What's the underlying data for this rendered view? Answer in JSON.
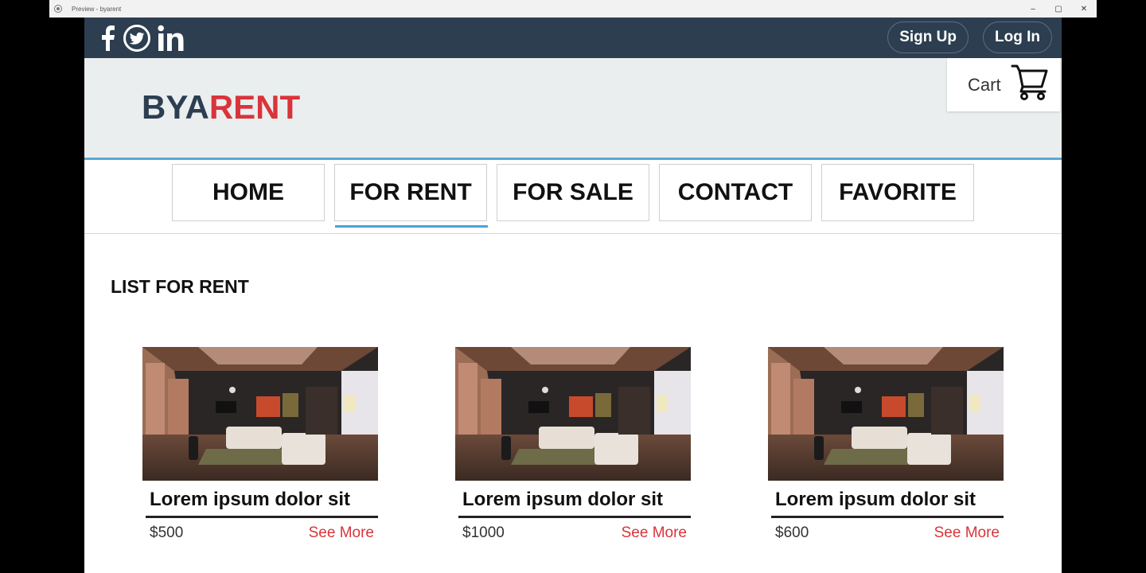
{
  "window": {
    "title": "Preview - byarent",
    "controls": [
      "–",
      "▢",
      "✕"
    ]
  },
  "topbar": {
    "social_icons": [
      "facebook-icon",
      "twitter-icon",
      "linkedin-icon"
    ],
    "sign_up": "Sign Up",
    "log_in": "Log In"
  },
  "header": {
    "logo_part1": "BYA",
    "logo_part2": "RENT",
    "cart_label": "Cart"
  },
  "nav": {
    "items": [
      {
        "label": "HOME",
        "active": false
      },
      {
        "label": "FOR RENT",
        "active": true
      },
      {
        "label": "FOR SALE",
        "active": false
      },
      {
        "label": "CONTACT",
        "active": false
      },
      {
        "label": "FAVORITE",
        "active": false
      }
    ]
  },
  "main": {
    "section_title": "LIST FOR RENT",
    "listings": [
      {
        "title": "Lorem ipsum dolor sit",
        "price": "$500",
        "link": "See More"
      },
      {
        "title": "Lorem ipsum dolor sit",
        "price": "$1000",
        "link": "See More"
      },
      {
        "title": "Lorem ipsum dolor sit",
        "price": "$600",
        "link": "See More"
      }
    ]
  },
  "colors": {
    "topbar": "#2c3e50",
    "brand_dark": "#2c3e50",
    "brand_red": "#d9343a",
    "accent_blue": "#4ba3d9"
  }
}
